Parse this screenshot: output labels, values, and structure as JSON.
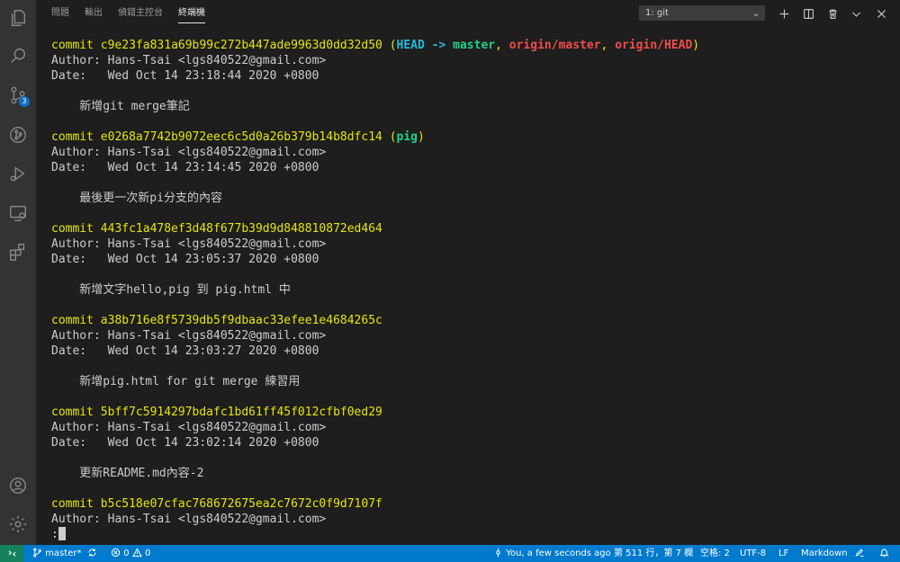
{
  "activity_bar": {
    "scm_badge": "3"
  },
  "panel": {
    "tabs": [
      {
        "label": "問題"
      },
      {
        "label": "輸出"
      },
      {
        "label": "偵錯主控台"
      },
      {
        "label": "終端機"
      }
    ],
    "terminal_select": "1: git",
    "chevron": "⌄"
  },
  "terminal": {
    "commits": [
      {
        "commit_prefix": "commit ",
        "hash": "c9e23fa831a69b99c272b447ade9963d0dd32d50",
        "refs_open": " (",
        "ref_head": "HEAD -> ",
        "ref_master": "master",
        "ref_sep1": ", ",
        "ref_origin_master": "origin/master",
        "ref_sep2": ", ",
        "ref_origin_head": "origin/HEAD",
        "refs_close": ")",
        "author": "Author: Hans-Tsai <lgs840522@gmail.com>",
        "date": "Date:   Wed Oct 14 23:18:44 2020 +0800",
        "message": "    新增git merge筆記"
      },
      {
        "commit_prefix": "commit ",
        "hash": "e0268a7742b9072eec6c5d0a26b379b14b8dfc14",
        "refs_open": " (",
        "ref_pig": "pig",
        "refs_close": ")",
        "author": "Author: Hans-Tsai <lgs840522@gmail.com>",
        "date": "Date:   Wed Oct 14 23:14:45 2020 +0800",
        "message": "    最後更一次新pi分支的內容"
      },
      {
        "commit_line": "commit 443fc1a478ef3d48f677b39d9d848810872ed464",
        "author": "Author: Hans-Tsai <lgs840522@gmail.com>",
        "date": "Date:   Wed Oct 14 23:05:37 2020 +0800",
        "message": "    新增文字hello,pig 到 pig.html 中"
      },
      {
        "commit_line": "commit a38b716e8f5739db5f9dbaac33efee1e4684265c",
        "author": "Author: Hans-Tsai <lgs840522@gmail.com>",
        "date": "Date:   Wed Oct 14 23:03:27 2020 +0800",
        "message": "    新增pig.html for git merge 練習用"
      },
      {
        "commit_line": "commit 5bff7c5914297bdafc1bd61ff45f012cfbf0ed29",
        "author": "Author: Hans-Tsai <lgs840522@gmail.com>",
        "date": "Date:   Wed Oct 14 23:02:14 2020 +0800",
        "message": "    更新README.md內容-2"
      },
      {
        "commit_line": "commit b5c518e07cfac768672675ea2c7672c0f9d7107f",
        "author": "Author: Hans-Tsai <lgs840522@gmail.com>"
      }
    ],
    "prompt": ":"
  },
  "statusbar": {
    "branch": "master*",
    "errors": "0",
    "warnings": "0",
    "blame": "You, a few seconds ago",
    "position": "第 511 行，第 7 欄",
    "spaces": "空格: 2",
    "encoding": "UTF-8",
    "eol": "LF",
    "language": "Markdown"
  }
}
